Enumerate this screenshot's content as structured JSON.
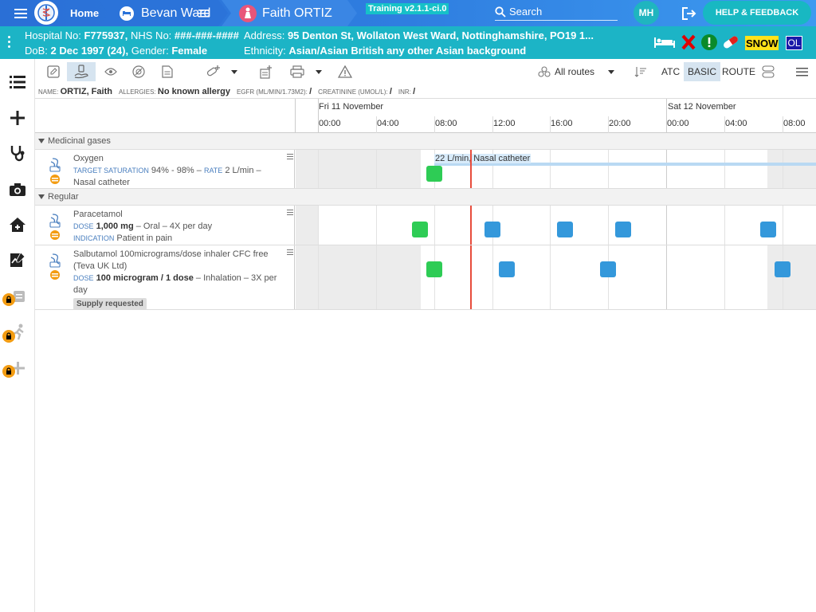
{
  "topbar": {
    "home_label": "Home",
    "ward_label": "Bevan Ward",
    "patient_label": "Faith ORTIZ",
    "training_label": "Training v2.1.1-ci.0",
    "search_placeholder": "Search",
    "avatar_initials": "MH",
    "help_label": "HELP & FEEDBACK"
  },
  "banner": {
    "hospital_label": "Hospital No:",
    "hospital_no": "F775937,",
    "nhs_label": "NHS No:",
    "nhs_no": "###-###-####",
    "address_label": "Address:",
    "address": "95 Denton St, Wollaton West Ward, Nottinghamshire, PO19 1...",
    "dob_label": "DoB:",
    "dob": "2 Dec 1997 (24),",
    "gender_label": "Gender:",
    "gender": "Female",
    "ethnicity_label": "Ethnicity:",
    "ethnicity": "Asian/Asian British any other Asian background",
    "snow_label": "SNOW",
    "ol_label": "OL"
  },
  "toolbar": {
    "routes_label": "All routes",
    "atc_label": "ATC",
    "basic_label": "BASIC",
    "route_label": "ROUTE"
  },
  "infostrip": {
    "name_label": "NAME:",
    "name": "ORTIZ, Faith",
    "allergies_label": "ALLERGIES:",
    "allergies": "No known allergy",
    "egfr_label": "EGFR (ML/MIN/1.73M2):",
    "egfr": "/",
    "creatinine_label": "CREATININE (UMOL/L):",
    "creatinine": "/",
    "inr_label": "INR:",
    "inr": "/"
  },
  "timeline": {
    "days": [
      "Fri 11 November",
      "Sat 12 November"
    ],
    "hours": [
      "00:00",
      "04:00",
      "08:00",
      "12:00",
      "16:00",
      "20:00",
      "00:00",
      "04:00",
      "08:00"
    ]
  },
  "sections": [
    {
      "title": "Medicinal gases",
      "rows": [
        {
          "name": "Oxygen",
          "target_label": "TARGET SATURATION",
          "target": "94% - 98%",
          "rate_label": "RATE",
          "rate": "2 L/min",
          "route": "Nasal catheter",
          "infusion_label": "22 L/min, Nasal catheter"
        }
      ]
    },
    {
      "title": "Regular",
      "rows": [
        {
          "name": "Paracetamol",
          "dose_label": "DOSE",
          "dose": "1,000 mg",
          "route_freq": "– Oral – 4X per day",
          "indication_label": "INDICATION",
          "indication": "Patient in pain"
        },
        {
          "name": "Salbutamol 100micrograms/dose inhaler CFC free (Teva UK Ltd)",
          "dose_label": "DOSE",
          "dose": "100 microgram / 1 dose",
          "route_freq": "– Inhalation – 3X per day",
          "badge": "Supply requested"
        }
      ]
    }
  ],
  "colors": {
    "topbar": "#2f7ee0",
    "banner": "#1cb4c6",
    "given": "#2ecc55",
    "due": "#3498db",
    "now_line": "#e74c3c",
    "lock": "#f39c12"
  }
}
